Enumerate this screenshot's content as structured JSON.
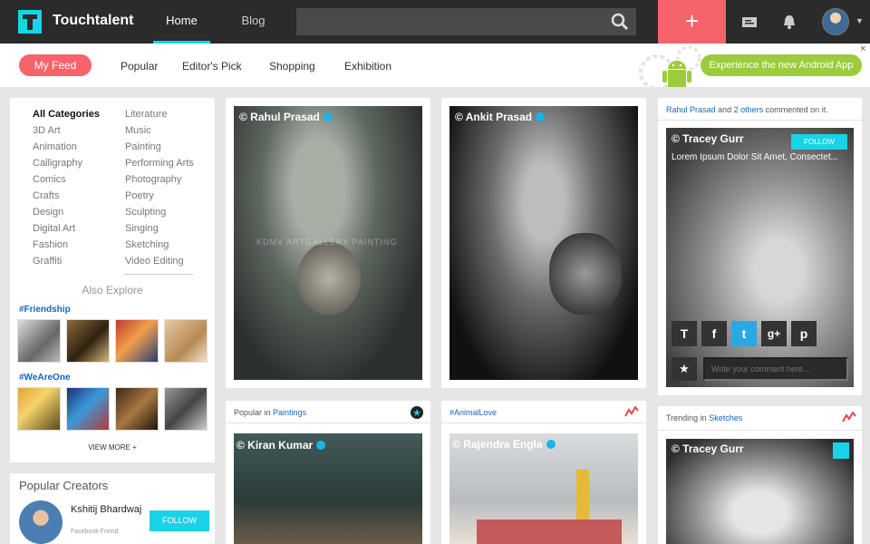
{
  "header": {
    "brand": "Touchtalent",
    "tabs": [
      {
        "label": "Home",
        "active": true
      },
      {
        "label": "Blog",
        "active": false
      }
    ],
    "add_label": "+",
    "accent": "#19d3e8",
    "add_color": "#f6636a"
  },
  "subnav": {
    "myfeed": "My Feed",
    "items": [
      "Popular",
      "Editor's Pick",
      "Shopping",
      "Exhibition"
    ],
    "promo": "Experience the new Android App",
    "close": "×"
  },
  "sidebar": {
    "categories_left": [
      "All Categories",
      "3D Art",
      "Animation",
      "Calligraphy",
      "Comics",
      "Crafts",
      "Design",
      "Digital Art",
      "Fashion",
      "Graffiti"
    ],
    "categories_right": [
      "Literature",
      "Music",
      "Painting",
      "Performing Arts",
      "Photography",
      "Poetry",
      "Sculpting",
      "Singing",
      "Sketching",
      "Video Editing"
    ],
    "also_explore": "Also Explore",
    "tags": [
      "#Friendship",
      "#WeAreOne"
    ],
    "view_more": "VIEW MORE +"
  },
  "creators": {
    "title": "Popular Creators",
    "name": "Kshitij Bhardwaj",
    "subtitle": "Facebook Friend",
    "follow": "FOLLOW"
  },
  "cards": {
    "c1": {
      "credit": "© Rahul Prasad",
      "watermark": "KDMV ARTGALLERY PAINTING"
    },
    "c2": {
      "credit": "© Ankit Prasad"
    },
    "c3": {
      "head_user": "Rahul Prasad",
      "head_and": "and",
      "head_others": "2 others",
      "head_tail": "commented on it.",
      "credit": "© Tracey Gurr",
      "follow": "FOLLOW",
      "text": "Lorem Ipsum Dolor Sit Amet, Consectet...",
      "comment_placeholder": "Write your comment here...",
      "social": [
        "T",
        "f",
        "t",
        "g+",
        "p"
      ]
    },
    "c4": {
      "head_pre": "Popular in",
      "head_link": "Paintings",
      "credit": "© Kiran Kumar"
    },
    "c5": {
      "head_link": "#AnimalLove",
      "credit": "© Rajendra Engla"
    },
    "c6": {
      "head_pre": "Trending in",
      "head_link": "Sketches",
      "credit": "© Tracey Gurr"
    }
  }
}
